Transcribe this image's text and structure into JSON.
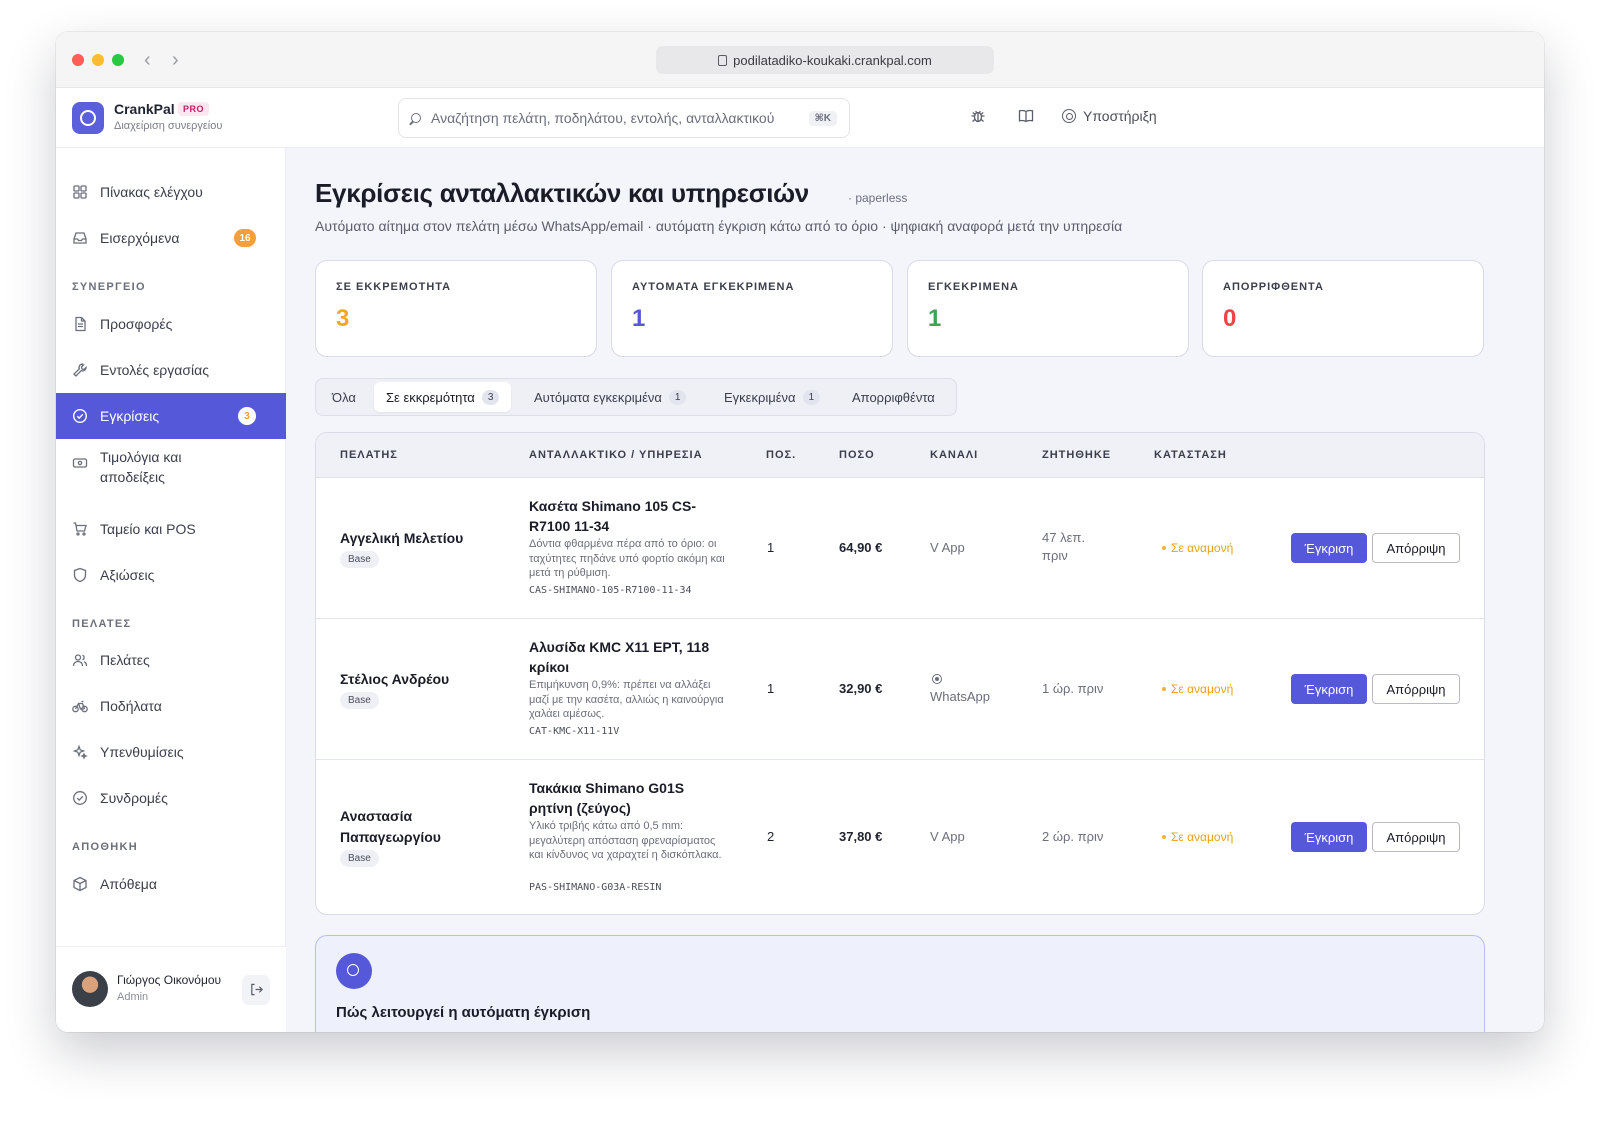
{
  "browser": {
    "url": "podilatadiko-koukaki.crankpal.com"
  },
  "brand": {
    "name": "CrankPal",
    "badge": "PRO",
    "subtitle": "Διαχείριση συνεργείου"
  },
  "search": {
    "placeholder": "Αναζήτηση πελάτη, ποδηλάτου, εντολής, ανταλλακτικού",
    "shortcut": "⌘K"
  },
  "header": {
    "support_label": "Υποστήριξη"
  },
  "sidebar": {
    "dashboard": "Πίνακας ελέγχου",
    "inbox": "Εισερχόμενα",
    "inbox_count": "16",
    "section_workshop": "ΣΥΝΕΡΓΕΙΟ",
    "quotes": "Προσφορές",
    "work_orders": "Εντολές εργασίας",
    "approvals": "Εγκρίσεις",
    "approvals_count": "3",
    "invoices": "Τιμολόγια και αποδείξεις",
    "pos": "Ταμείο και POS",
    "claims": "Αξιώσεις",
    "section_customers": "ΠΕΛΑΤΕΣ",
    "customers": "Πελάτες",
    "bikes": "Ποδήλατα",
    "reminders": "Υπενθυμίσεις",
    "subscriptions": "Συνδρομές",
    "section_warehouse": "ΑΠΟΘΗΚΗ",
    "stock": "Απόθεμα"
  },
  "user": {
    "name": "Γιώργος Οικονόμου",
    "role": "Admin"
  },
  "page": {
    "title": "Εγκρίσεις ανταλλακτικών και υπηρεσιών",
    "tag": "· paperless",
    "subtitle": "Αυτόματο αίτημα στον πελάτη μέσω WhatsApp/email · αυτόματη έγκριση κάτω από το όριο · ψηφιακή αναφορά μετά την υπηρεσία"
  },
  "stats": [
    {
      "label": "ΣΕ ΕΚΚΡΕΜΟΤΗΤΑ",
      "value": "3",
      "color": "#f5a623"
    },
    {
      "label": "ΑΥΤΟΜΑΤΑ ΕΓΚΕΚΡΙΜΕΝΑ",
      "value": "1",
      "color": "#5558d9"
    },
    {
      "label": "ΕΓΚΕΚΡΙΜΕΝΑ",
      "value": "1",
      "color": "#3aa655"
    },
    {
      "label": "ΑΠΟΡΡΙΦΘΕΝΤΑ",
      "value": "0",
      "color": "#ef4444"
    }
  ],
  "tabs": [
    {
      "label": "Όλα",
      "count": ""
    },
    {
      "label": "Σε εκκρεμότητα",
      "count": "3"
    },
    {
      "label": "Αυτόματα εγκεκριμένα",
      "count": "1"
    },
    {
      "label": "Εγκεκριμένα",
      "count": "1"
    },
    {
      "label": "Απορριφθέντα",
      "count": ""
    }
  ],
  "table": {
    "headers": [
      "ΠΕΛΑΤΗΣ",
      "ΑΝΤΑΛΛΑΚΤΙΚΟ / ΥΠΗΡΕΣΙΑ",
      "ΠΟΣ.",
      "ΠΟΣΟ",
      "ΚΑΝΑΛΙ",
      "ΖΗΤΗΘΗΚΕ",
      "ΚΑΤΑΣΤΑΣΗ"
    ],
    "approve_label": "Έγκριση",
    "reject_label": "Απόρριψη",
    "rows": [
      {
        "customer": "Αγγελική Μελετίου",
        "tier": "Base",
        "part": "Κασέτα Shimano 105 CS-R7100 11-34",
        "note": "Δόντια φθαρμένα πέρα από το όριο: οι ταχύτητες πηδάνε υπό φορτίο ακόμη και μετά τη ρύθμιση.",
        "sku": "CAS-SHIMANO-105-R7100-11-34",
        "qty": "1",
        "amount": "64,90 €",
        "channel": "V App",
        "requested": "47 λεπ. πριν",
        "status": "Σε αναμονή"
      },
      {
        "customer": "Στέλιος Ανδρέου",
        "tier": "Base",
        "part": "Αλυσίδα KMC X11 EPT, 118 κρίκοι",
        "note": "Επιμήκυνση 0,9%: πρέπει να αλλάξει μαζί με την κασέτα, αλλιώς η καινούργια χαλάει αμέσως.",
        "sku": "CAT-KMC-X11-11V",
        "qty": "1",
        "amount": "32,90 €",
        "channel": "WhatsApp",
        "requested": "1 ώρ. πριν",
        "status": "Σε αναμονή"
      },
      {
        "customer": "Αναστασία Παπαγεωργίου",
        "tier": "Base",
        "part": "Τακάκια Shimano G01S ρητίνη (ζεύγος)",
        "note": "Υλικό τριβής κάτω από 0,5 mm: μεγαλύτερη απόσταση φρεναρίσματος και κίνδυνος να χαραχτεί η δισκόπλακα.",
        "sku": "PAS-SHIMANO-G03A-RESIN",
        "qty": "2",
        "amount": "37,80 €",
        "channel": "V App",
        "requested": "2 ώρ. πριν",
        "status": "Σε αναμονή"
      }
    ]
  },
  "info": {
    "title": "Πώς λειτουργεί η αυτόματη έγκριση"
  }
}
